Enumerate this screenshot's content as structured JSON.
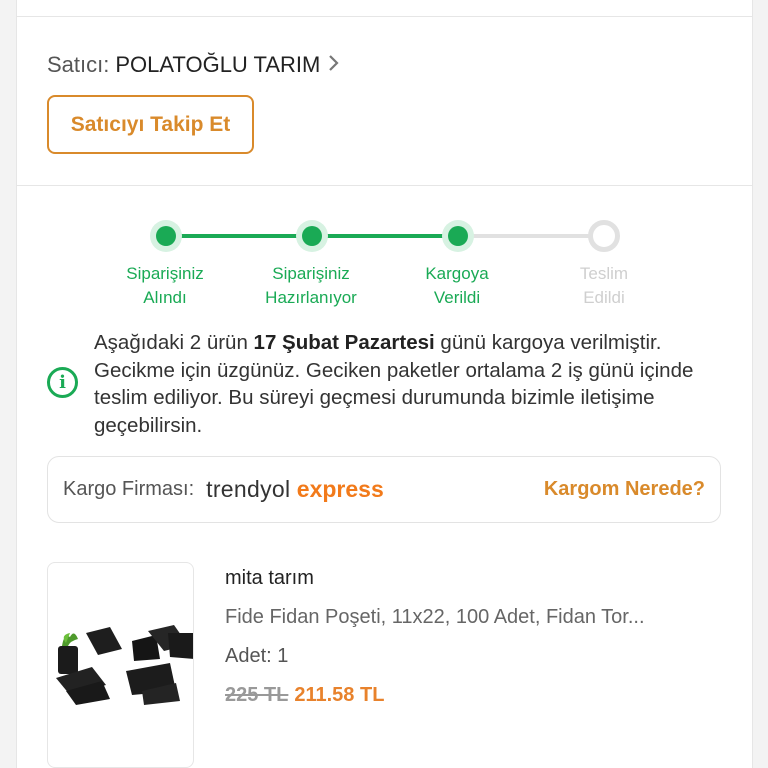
{
  "seller": {
    "prefix": "Satıcı:",
    "name": "POLATOĞLU TARIM",
    "follow_button": "Satıcıyı Takip Et"
  },
  "tracker": {
    "steps": [
      {
        "line1": "Siparişiniz",
        "line2": "Alındı",
        "status": "done"
      },
      {
        "line1": "Siparişiniz",
        "line2": "Hazırlanıyor",
        "status": "done"
      },
      {
        "line1": "Kargoya",
        "line2": "Verildi",
        "status": "done"
      },
      {
        "line1": "Teslim",
        "line2": "Edildi",
        "status": "todo"
      }
    ],
    "colors": {
      "done": "#1aaa55",
      "todo": "#e1e1e1"
    }
  },
  "notice": {
    "part1": "Aşağıdaki 2 ürün ",
    "date": "17 Şubat Pazartesi",
    "part2": " günü kargoya verilmiştir. Gecikme için üzgünüz. Geciken paketler ortalama 2 iş günü içinde teslim ediliyor. Bu süreyi geçmesi durumunda bizimle iletişime geçebilirsin."
  },
  "cargo": {
    "label": "Kargo Firması:",
    "brand_part1": "trendyol",
    "brand_part2": "express",
    "link": "Kargom Nerede?"
  },
  "product": {
    "store": "mita tarım",
    "name": "Fide Fidan Poşeti, 11x22, 100 Adet, Fidan Tor...",
    "quantity": "Adet: 1",
    "old_price": "225 TL",
    "new_price": "211.58 TL"
  },
  "colors": {
    "accent": "#d98a2b",
    "success": "#1aaa55",
    "brand_orange": "#f27a1a"
  }
}
